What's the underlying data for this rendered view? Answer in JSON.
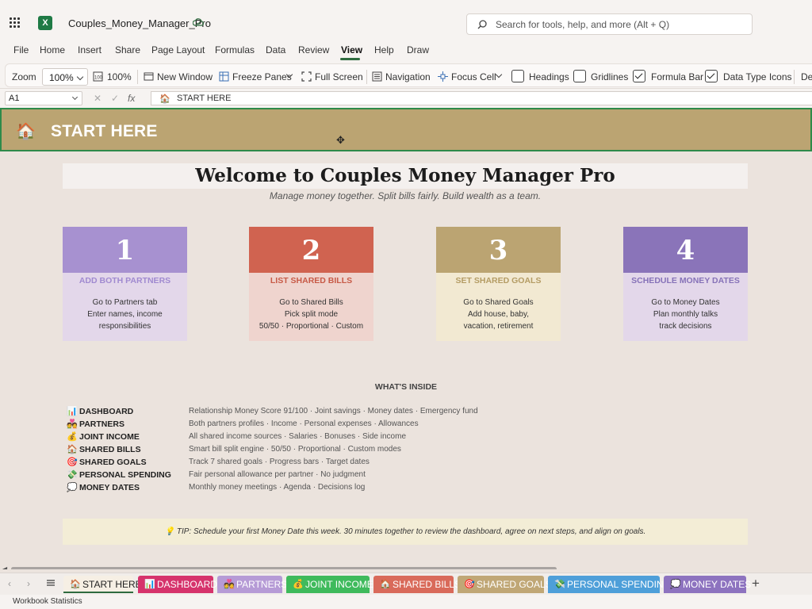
{
  "app": {
    "filename": "Couples_Money_Manager_Pro",
    "logo_letter": "X"
  },
  "search": {
    "placeholder": "Search for tools, help, and more (Alt + Q)"
  },
  "menu": [
    "File",
    "Home",
    "Insert",
    "Share",
    "Page Layout",
    "Formulas",
    "Data",
    "Review",
    "View",
    "Help",
    "Draw"
  ],
  "menu_active": "View",
  "ribbon": {
    "zoom_label": "Zoom",
    "zoom_value": "100%",
    "zoom100": "100%",
    "new_window": "New Window",
    "freeze_panes": "Freeze Panes",
    "full_screen": "Full Screen",
    "navigation": "Navigation",
    "focus_cell": "Focus Cell",
    "headings": "Headings",
    "gridlines": "Gridlines",
    "formula_bar": "Formula Bar",
    "data_type_icons": "Data Type Icons",
    "overflow": "De",
    "headings_checked": false,
    "gridlines_checked": false,
    "formula_bar_checked": true,
    "data_type_icons_checked": true
  },
  "formula_bar": {
    "cell_ref": "A1",
    "fx": "fx",
    "content": "START HERE",
    "content_icon": "🏠"
  },
  "sheet": {
    "banner_icon": "🏠",
    "banner_title": "START HERE",
    "welcome_title": "Welcome to Couples Money Manager Pro",
    "tagline": "Manage money together. Split bills fairly. Build wealth as a team.",
    "steps": [
      {
        "number": "1",
        "title": "ADD BOTH PARTNERS",
        "lines": [
          "Go to Partners tab",
          "Enter names, income",
          "responsibilities"
        ],
        "header_color": "#a791d0",
        "body_color": "#e3d7ea",
        "title_color": "#a08ad0"
      },
      {
        "number": "2",
        "title": "LIST SHARED BILLS",
        "lines": [
          "Go to Shared Bills",
          "Pick split mode",
          "50/50 · Proportional · Custom"
        ],
        "header_color": "#d06350",
        "body_color": "#efd4ce",
        "title_color": "#c75a47"
      },
      {
        "number": "3",
        "title": "SET SHARED GOALS",
        "lines": [
          "Go to Shared Goals",
          "Add house, baby,",
          "vacation, retirement"
        ],
        "header_color": "#bba472",
        "body_color": "#f2e9d2",
        "title_color": "#b49c64"
      },
      {
        "number": "4",
        "title": "SCHEDULE MONEY DATES",
        "lines": [
          "Go to Money Dates",
          "Plan monthly talks",
          "track decisions"
        ],
        "header_color": "#8a74b9",
        "body_color": "#e3d7ea",
        "title_color": "#8672b8"
      }
    ],
    "inside_heading": "WHAT'S INSIDE",
    "inside": [
      {
        "icon": "📊",
        "name": "DASHBOARD",
        "desc": "Relationship Money Score 91/100 · Joint savings · Money dates · Emergency fund"
      },
      {
        "icon": "💑",
        "name": "PARTNERS",
        "desc": "Both partners profiles · Income · Personal expenses · Allowances"
      },
      {
        "icon": "💰",
        "name": "JOINT INCOME",
        "desc": "All shared income sources · Salaries · Bonuses · Side income"
      },
      {
        "icon": "🏠",
        "name": "SHARED BILLS",
        "desc": "Smart bill split engine · 50/50 · Proportional · Custom modes"
      },
      {
        "icon": "🎯",
        "name": "SHARED GOALS",
        "desc": "Track 7 shared goals · Progress bars · Target dates"
      },
      {
        "icon": "💸",
        "name": "PERSONAL SPENDING",
        "desc": "Fair personal allowance per partner · No judgment"
      },
      {
        "icon": "💭",
        "name": "MONEY DATES",
        "desc": "Monthly money meetings · Agenda · Decisions log"
      }
    ],
    "tip": "💡 TIP: Schedule your first Money Date this week. 30 minutes together to review the dashboard, agree on next steps, and align on goals."
  },
  "tabs": [
    {
      "icon": "🏠",
      "label": "START HERE",
      "bg": "#f6efe4",
      "fg": "#222",
      "active": true
    },
    {
      "icon": "📊",
      "label": "DASHBOARD",
      "bg": "#d6336c",
      "fg": "#ffffff"
    },
    {
      "icon": "💑",
      "label": "PARTNERS",
      "bg": "#b69bd6",
      "fg": "#ffffff"
    },
    {
      "icon": "💰",
      "label": "JOINT INCOME",
      "bg": "#3fba5c",
      "fg": "#ffffff"
    },
    {
      "icon": "🏠",
      "label": "SHARED BILLS",
      "bg": "#d96a5a",
      "fg": "#ffffff"
    },
    {
      "icon": "🎯",
      "label": "SHARED GOALS",
      "bg": "#c0a776",
      "fg": "#ffffff"
    },
    {
      "icon": "💸",
      "label": "PERSONAL SPENDING",
      "bg": "#4e9fd9",
      "fg": "#ffffff"
    },
    {
      "icon": "💭",
      "label": "MONEY DATES",
      "bg": "#8d73bf",
      "fg": "#ffffff"
    }
  ],
  "status": {
    "text": "Workbook Statistics"
  }
}
